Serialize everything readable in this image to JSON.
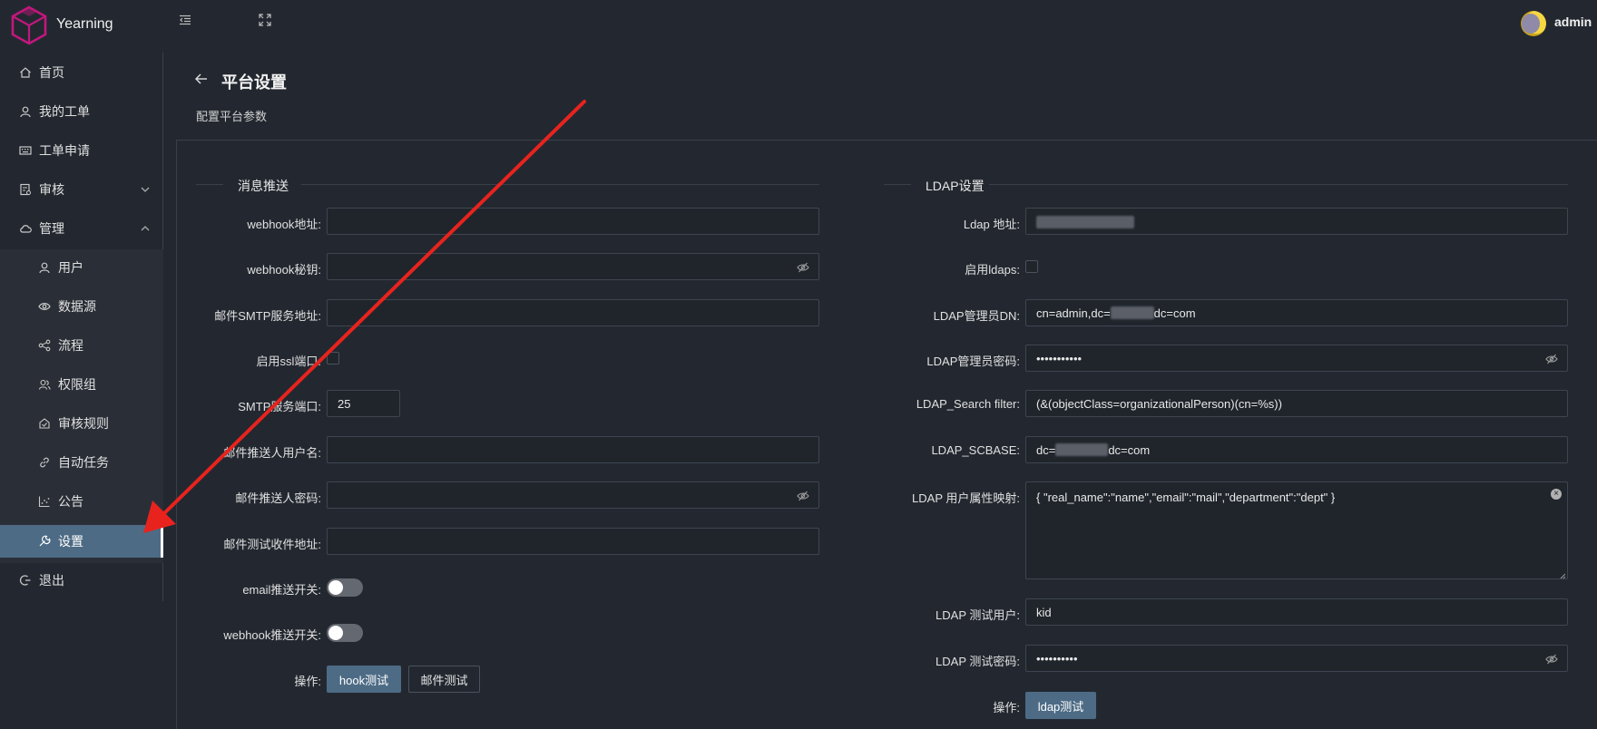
{
  "app": {
    "name": "Yearning",
    "user": "admin"
  },
  "colors": {
    "accent": "#4d6b85",
    "background": "#232830",
    "annotation_arrow": "#e8231d"
  },
  "icons": {
    "menu_toggle": "menu-fold-icon",
    "fullscreen": "fullscreen-icon",
    "back": "arrow-left-icon"
  },
  "sidebar": {
    "items": [
      {
        "label": "首页",
        "icon": "home-icon"
      },
      {
        "label": "我的工单",
        "icon": "user-icon"
      },
      {
        "label": "工单申请",
        "icon": "keyboard-icon"
      },
      {
        "label": "审核",
        "icon": "audit-icon",
        "expanded": false
      },
      {
        "label": "管理",
        "icon": "cloud-icon",
        "expanded": true
      },
      {
        "label": "用户",
        "icon": "user-icon"
      },
      {
        "label": "数据源",
        "icon": "eye-icon"
      },
      {
        "label": "流程",
        "icon": "share-icon"
      },
      {
        "label": "权限组",
        "icon": "usergroup-icon"
      },
      {
        "label": "审核规则",
        "icon": "rule-icon"
      },
      {
        "label": "自动任务",
        "icon": "link-icon"
      },
      {
        "label": "公告",
        "icon": "chart-icon"
      },
      {
        "label": "设置",
        "icon": "tool-icon",
        "active": true
      },
      {
        "label": "退出",
        "icon": "logout-icon"
      }
    ]
  },
  "page": {
    "title": "平台设置",
    "subtitle": "配置平台参数"
  },
  "message": {
    "section_title": "消息推送",
    "webhook_url_label": "webhook地址:",
    "webhook_url_value": "",
    "webhook_secret_label": "webhook秘钥:",
    "webhook_secret_value": "",
    "smtp_host_label": "邮件SMTP服务地址:",
    "smtp_host_value": "",
    "ssl_label": "启用ssl端口:",
    "ssl_checked": false,
    "smtp_port_label": "SMTP服务端口:",
    "smtp_port_value": "25",
    "sender_user_label": "邮件推送人用户名:",
    "sender_user_value": "",
    "sender_password_label": "邮件推送人密码:",
    "sender_password_value": "",
    "test_recipient_label": "邮件测试收件地址:",
    "test_recipient_value": "",
    "email_switch_label": "email推送开关:",
    "email_switch_on": false,
    "webhook_switch_label": "webhook推送开关:",
    "webhook_switch_on": false,
    "actions_label": "操作:",
    "hook_test_button": "hook测试",
    "mail_test_button": "邮件测试"
  },
  "ldap": {
    "section_title": "LDAP设置",
    "url_label": "Ldap 地址:",
    "ldaps_label": "启用ldaps:",
    "ldaps_checked": false,
    "admin_dn_label": "LDAP管理员DN:",
    "admin_dn_prefix": "cn=admin,dc=",
    "admin_dn_suffix": "dc=com",
    "admin_password_label": "LDAP管理员密码:",
    "admin_password_value": "•••••••••••",
    "search_filter_label": "LDAP_Search filter:",
    "search_filter_value": "(&(objectClass=organizationalPerson)(cn=%s))",
    "scbase_label": "LDAP_SCBASE:",
    "scbase_prefix": "dc=",
    "scbase_suffix": "dc=com",
    "mapping_label": "LDAP 用户属性映射:",
    "mapping_value": "{ \"real_name\":\"name\",\"email\":\"mail\",\"department\":\"dept\" }",
    "test_user_label": "LDAP 测试用户:",
    "test_user_value": "kid",
    "test_password_label": "LDAP 测试密码:",
    "test_password_value": "••••••••••",
    "actions_label": "操作:",
    "ldap_test_button": "ldap测试"
  }
}
